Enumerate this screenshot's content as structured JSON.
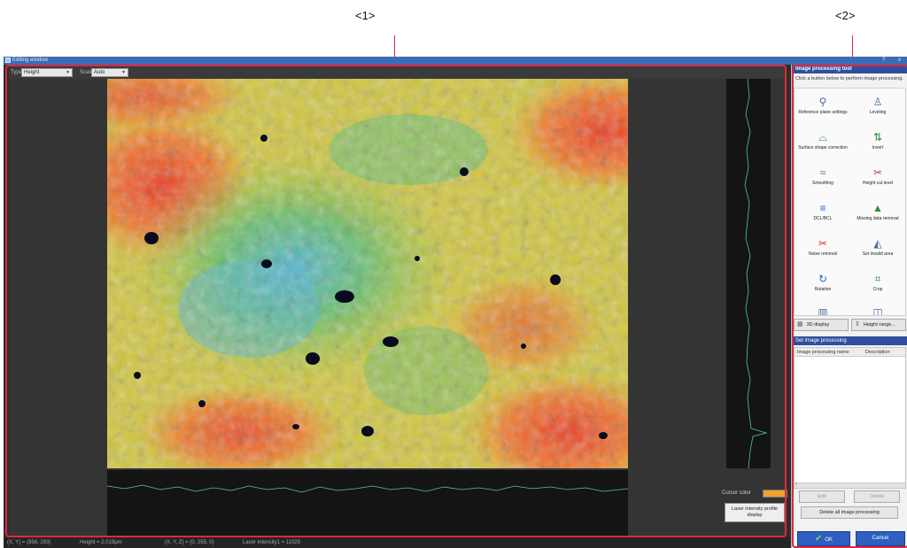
{
  "callouts": {
    "one": "<1>",
    "two": "<2>"
  },
  "window": {
    "title": "Editing window",
    "controls": [
      "?",
      "x"
    ]
  },
  "toolbar": {
    "type_label": "Type",
    "type_value": "Height",
    "scale_label": "Scale",
    "scale_value": "Auto"
  },
  "viewer": {
    "cursor_color_label": "Cursor color",
    "cursor_color": "#f0a030",
    "laser_button": "Laser intensity profile display"
  },
  "statusbar": {
    "xy": "(X, Y) = (956, 293)",
    "height": "Height = 2.019μm",
    "xy2": "(X, Y, Z) = (0, 255, 0)",
    "laser": "Laser intensity1 = 11025"
  },
  "panel": {
    "header": "Image processing tool",
    "description": "Click a button below to perform image processing.",
    "tools": [
      {
        "label": "Reference plane settings",
        "icon": "reference-plane-icon",
        "glyph": "⚲"
      },
      {
        "label": "Leveling",
        "icon": "leveling-icon",
        "glyph": "♙"
      },
      {
        "label": "Surface shape correction",
        "icon": "surface-shape-icon",
        "glyph": "⌓"
      },
      {
        "label": "Invert",
        "icon": "invert-icon",
        "glyph": "⇅"
      },
      {
        "label": "Smoothing",
        "icon": "smoothing-icon",
        "glyph": "≈"
      },
      {
        "label": "Height cut level",
        "icon": "height-cut-icon",
        "glyph": "✂"
      },
      {
        "label": "DCL/BCL",
        "icon": "dcl-bcl-icon",
        "glyph": "≡"
      },
      {
        "label": "Missing data removal",
        "icon": "missing-data-icon",
        "glyph": "▲"
      },
      {
        "label": "Noise removal",
        "icon": "noise-removal-icon",
        "glyph": "✂"
      },
      {
        "label": "Set invalid area",
        "icon": "invalid-area-icon",
        "glyph": "◭"
      },
      {
        "label": "Rotation",
        "icon": "rotation-icon",
        "glyph": "↻"
      },
      {
        "label": "Crop",
        "icon": "crop-icon",
        "glyph": "⌗"
      },
      {
        "label": "",
        "icon": "histogram-icon",
        "glyph": "▥"
      },
      {
        "label": "",
        "icon": "more-icon",
        "glyph": "◫"
      }
    ],
    "display_3d": "3D display",
    "height_range": "Height range...",
    "list_header": "Set image processing",
    "col_name": "Image processing name",
    "col_desc": "Description",
    "edit": "Edit",
    "delete": "Delete",
    "delete_all": "Delete all image processing",
    "ok": "OK",
    "cancel": "Cancel"
  }
}
